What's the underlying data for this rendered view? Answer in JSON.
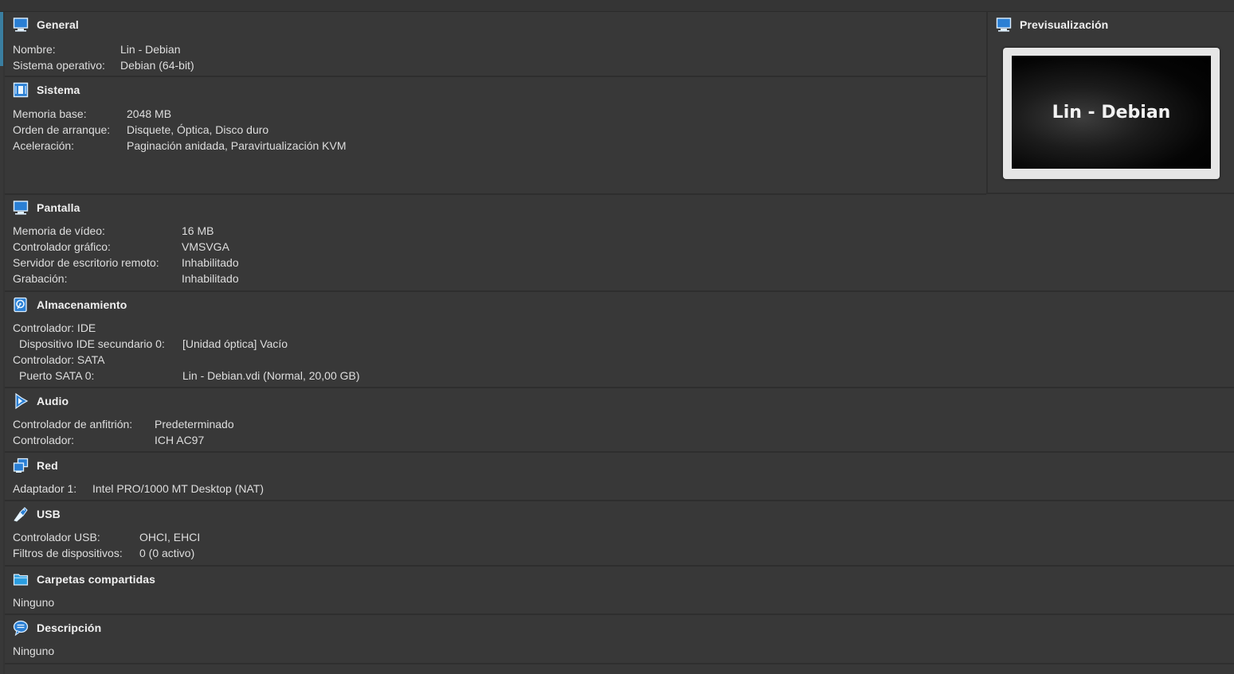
{
  "general": {
    "title": "General",
    "icon": "monitor-icon",
    "rows": [
      {
        "label": "Nombre:",
        "value": "Lin - Debian"
      },
      {
        "label": "Sistema operativo:",
        "value": "Debian (64-bit)"
      }
    ]
  },
  "sistema": {
    "title": "Sistema",
    "icon": "chip-icon",
    "rows": [
      {
        "label": "Memoria base:",
        "value": "2048 MB"
      },
      {
        "label": "Orden de arranque:",
        "value": "Disquete, Óptica, Disco duro"
      },
      {
        "label": "Aceleración:",
        "value": "Paginación anidada, Paravirtualización KVM"
      }
    ]
  },
  "preview": {
    "title": "Previsualización",
    "icon": "monitor-icon",
    "screen_text": "Lin - Debian"
  },
  "pantalla": {
    "title": "Pantalla",
    "icon": "monitor-icon",
    "rows": [
      {
        "label": "Memoria de vídeo:",
        "value": "16 MB"
      },
      {
        "label": "Controlador gráfico:",
        "value": "VMSVGA"
      },
      {
        "label": "Servidor de escritorio remoto:",
        "value": "Inhabilitado"
      },
      {
        "label": "Grabación:",
        "value": "Inhabilitado"
      }
    ]
  },
  "almacenamiento": {
    "title": "Almacenamiento",
    "icon": "disk-icon",
    "rows": [
      {
        "label": "Controlador: IDE",
        "value": ""
      },
      {
        "label": " Dispositivo IDE secundario 0:",
        "value": "[Unidad óptica] Vacío"
      },
      {
        "label": "Controlador: SATA",
        "value": ""
      },
      {
        "label": " Puerto SATA 0:",
        "value": "Lin - Debian.vdi (Normal, 20,00 GB)"
      }
    ]
  },
  "audio": {
    "title": "Audio",
    "icon": "speaker-icon",
    "rows": [
      {
        "label": "Controlador de anfitrión:",
        "value": "Predeterminado"
      },
      {
        "label": "Controlador:",
        "value": "ICH AC97"
      }
    ]
  },
  "red": {
    "title": "Red",
    "icon": "network-icon",
    "rows": [
      {
        "label": "Adaptador 1:",
        "value": "Intel PRO/1000 MT Desktop (NAT)"
      }
    ]
  },
  "usb": {
    "title": "USB",
    "icon": "usb-icon",
    "rows": [
      {
        "label": "Controlador USB:",
        "value": "OHCI, EHCI"
      },
      {
        "label": "Filtros de dispositivos:",
        "value": "0 (0 activo)"
      }
    ]
  },
  "carpetas": {
    "title": "Carpetas compartidas",
    "icon": "folder-icon",
    "rows": [
      {
        "label": "Ninguno",
        "value": ""
      }
    ]
  },
  "descripcion": {
    "title": "Descripción",
    "icon": "speech-bubble-icon",
    "rows": [
      {
        "label": "Ninguno",
        "value": ""
      }
    ]
  }
}
